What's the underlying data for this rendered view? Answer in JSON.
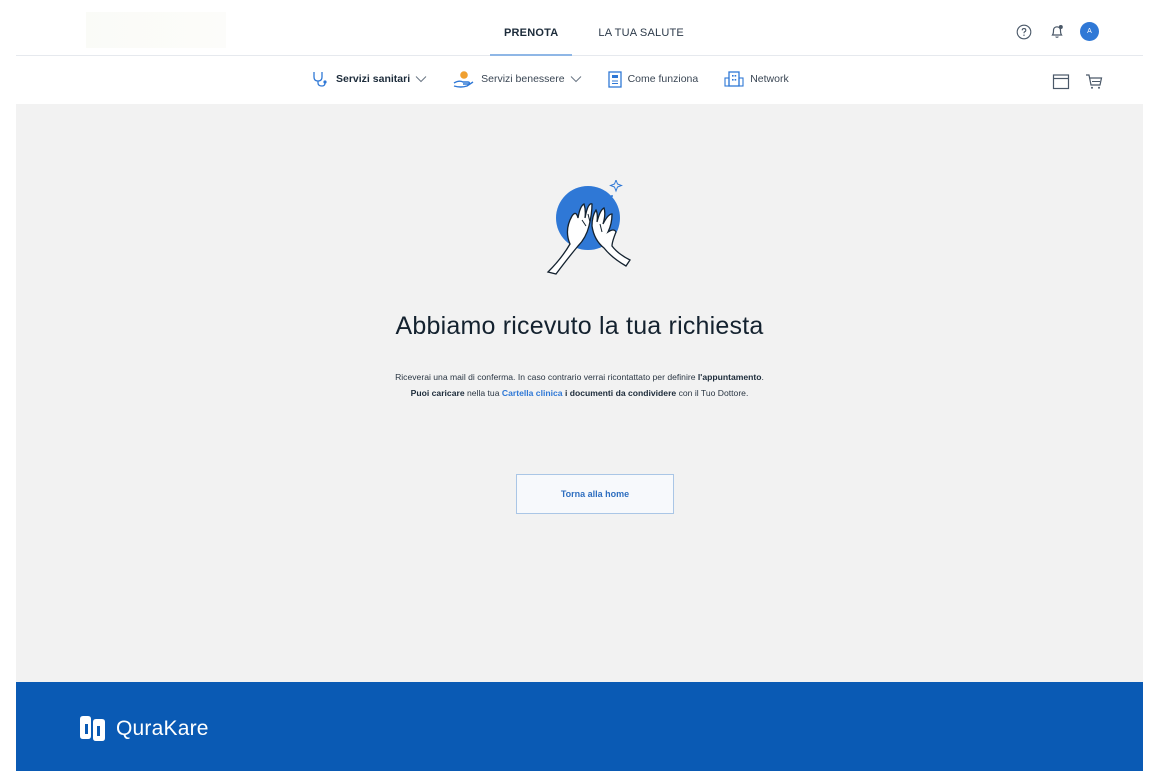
{
  "header": {
    "tabs": [
      {
        "label": "PRENOTA",
        "active": true
      },
      {
        "label": "LA TUA SALUTE",
        "active": false
      }
    ],
    "icons": [
      "help-icon",
      "notification-icon",
      "avatar"
    ],
    "avatar_initial": "A"
  },
  "subnav": {
    "items": [
      {
        "label": "Servizi sanitari",
        "icon": "stethoscope-icon",
        "dropdown": true
      },
      {
        "label": "Servizi benessere",
        "icon": "wellness-hand-icon",
        "dropdown": true
      },
      {
        "label": "Come funziona",
        "icon": "document-icon",
        "dropdown": false
      },
      {
        "label": "Network",
        "icon": "building-icon",
        "dropdown": false
      }
    ],
    "right_icons": [
      "calendar-icon",
      "cart-icon"
    ]
  },
  "confirmation": {
    "title": "Abbiamo ricevuto la tua richiesta",
    "line1_prefix": "Riceverai una mail di conferma. In caso contrario verrai ricontattato per definire ",
    "line1_bold": "l'appuntamento",
    "line1_suffix": ".",
    "line2_bold1": "Puoi caricare",
    "line2_text1": " nella tua ",
    "line2_link": "Cartella clinica",
    "line2_text2": " ",
    "line2_bold2": "i documenti da condividere",
    "line2_text3": " con il Tuo Dottore.",
    "button_label": "Torna alla home"
  },
  "footer": {
    "brand": "QuraKare"
  },
  "colors": {
    "primary": "#2f78d6",
    "footer_bg": "#0a5ab4",
    "content_bg": "#f2f2f2",
    "accent_orange": "#f0a030"
  }
}
